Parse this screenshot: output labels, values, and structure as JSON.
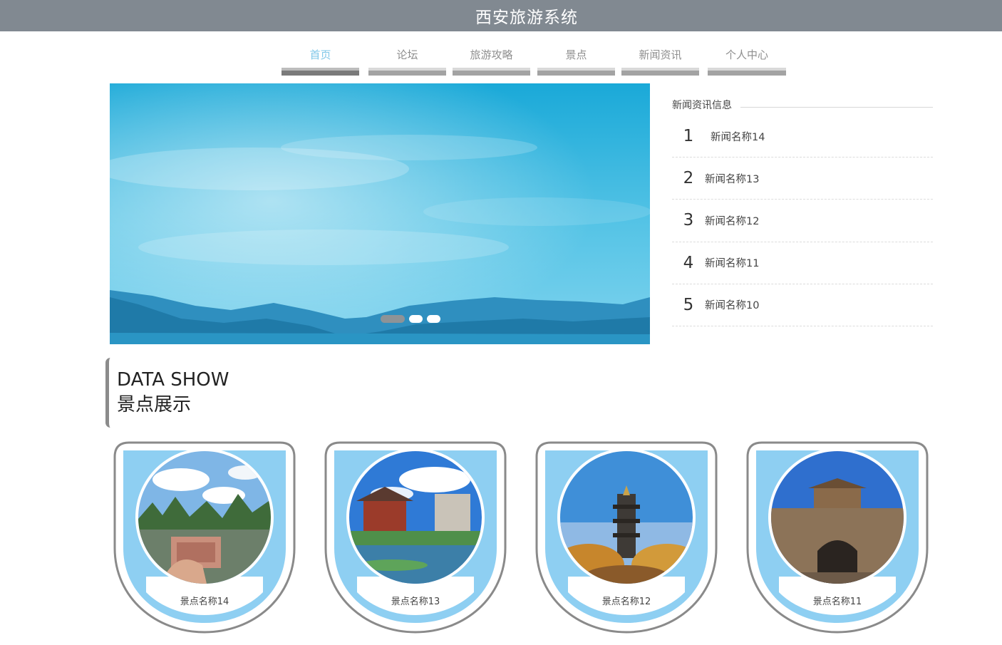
{
  "header": {
    "title": "西安旅游系统"
  },
  "nav": {
    "items": [
      {
        "label": "首页",
        "active": true
      },
      {
        "label": "论坛",
        "active": false
      },
      {
        "label": "旅游攻略",
        "active": false
      },
      {
        "label": "景点",
        "active": false
      },
      {
        "label": "新闻资讯",
        "active": false
      },
      {
        "label": "个人中心",
        "active": false
      }
    ]
  },
  "carousel": {
    "slide_count": 3,
    "active_index": 0
  },
  "news": {
    "heading": "新闻资讯信息",
    "items": [
      {
        "num": "1",
        "name": "新闻名称14"
      },
      {
        "num": "2",
        "name": "新闻名称13"
      },
      {
        "num": "3",
        "name": "新闻名称12"
      },
      {
        "num": "4",
        "name": "新闻名称11"
      },
      {
        "num": "5",
        "name": "新闻名称10"
      }
    ]
  },
  "section": {
    "title_en": "DATA SHOW",
    "title_cn": "景点展示"
  },
  "spots": {
    "items": [
      {
        "name": "景点名称14"
      },
      {
        "name": "景点名称13"
      },
      {
        "name": "景点名称12"
      },
      {
        "name": "景点名称11"
      }
    ]
  },
  "colors": {
    "header_bg": "#818991",
    "nav_active": "#7fc7e8",
    "card_fill": "#8ecff2",
    "card_border": "#8a8a8a"
  }
}
